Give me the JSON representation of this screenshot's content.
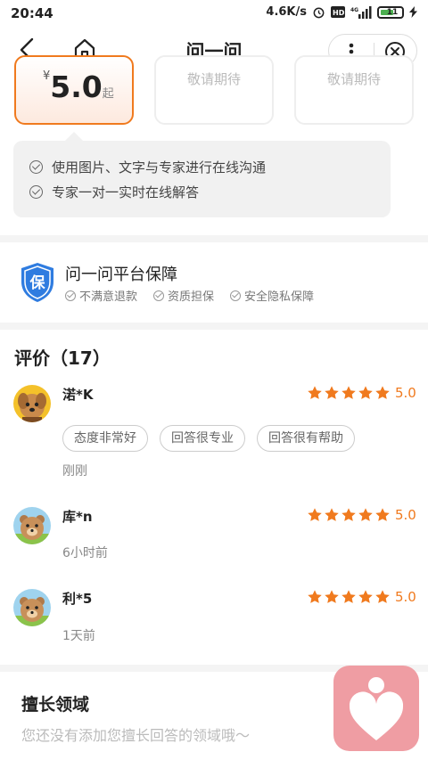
{
  "status_bar": {
    "time": "20:44",
    "speed": "4.6K/s",
    "battery": "11"
  },
  "nav": {
    "title": "问一问"
  },
  "price_card": {
    "currency": "¥",
    "price": "5.0",
    "suffix": "起"
  },
  "other_cards": [
    "敬请期待",
    "敬请期待"
  ],
  "tooltip": [
    "使用图片、文字与专家进行在线沟通",
    "专家一对一实时在线解答"
  ],
  "guarantee": {
    "badge": "保",
    "title": "问一问平台保障",
    "items": [
      "不满意退款",
      "资质担保",
      "安全隐私保障"
    ]
  },
  "reviews": {
    "title": "评价（17）",
    "items": [
      {
        "name": "渃*K",
        "score": "5.0",
        "tags": [
          "态度非常好",
          "回答很专业",
          "回答很有帮助"
        ],
        "time": "刚刚"
      },
      {
        "name": "库*n",
        "score": "5.0",
        "time": "6小时前"
      },
      {
        "name": "利*5",
        "score": "5.0",
        "time": "1天前"
      }
    ]
  },
  "skill": {
    "title": "擅长领域",
    "empty_text": "您还没有添加您擅长回答的领域哦～"
  },
  "colors": {
    "accent": "#f07a1e",
    "badge_blue": "#2f7ce0",
    "float_pink": "#ef9da3"
  }
}
